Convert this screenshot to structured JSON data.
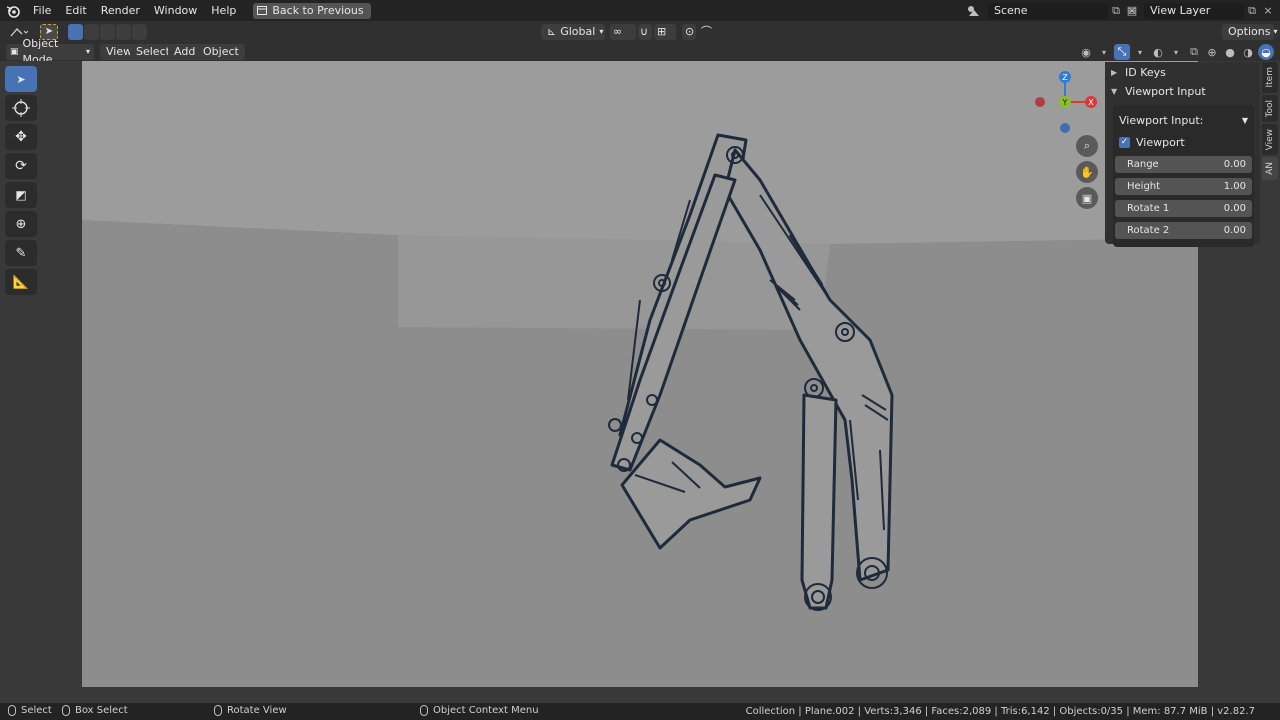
{
  "menu": {
    "items": [
      "File",
      "Edit",
      "Render",
      "Window",
      "Help"
    ],
    "back_button": "Back to Previous",
    "scene": "Scene",
    "view_layer": "View Layer"
  },
  "tool_header": {
    "orientation": "Global",
    "options": "Options"
  },
  "viewport_header": {
    "mode": "Object Mode",
    "menus": [
      "View",
      "Select",
      "Add",
      "Object"
    ]
  },
  "npanel": {
    "id_keys": "ID Keys",
    "viewport_input_header": "Viewport Input",
    "viewport_input_label": "Viewport Input:",
    "viewport_checkbox": "Viewport",
    "fields": [
      {
        "label": "Range",
        "value": "0.00"
      },
      {
        "label": "Height",
        "value": "1.00"
      },
      {
        "label": "Rotate 1",
        "value": "0.00"
      },
      {
        "label": "Rotate 2",
        "value": "0.00"
      }
    ]
  },
  "tabs": [
    "Item",
    "Tool",
    "View",
    "AN"
  ],
  "gizmo": {
    "z": "Z",
    "y": "Y",
    "x": "X"
  },
  "status": {
    "select": "Select",
    "box_select": "Box Select",
    "rotate_view": "Rotate View",
    "context_menu": "Object Context Menu",
    "stats": "Collection | Plane.002 | Verts:3,346 | Faces:2,089 | Tris:6,142 | Objects:0/35 | Mem: 87.7 MiB | v2.82.7"
  },
  "colors": {
    "accent": "#4772b3",
    "viewport_bg": "#8d8d8d",
    "stroke": "#1f2a3a",
    "fill": "#9a9a9a"
  }
}
